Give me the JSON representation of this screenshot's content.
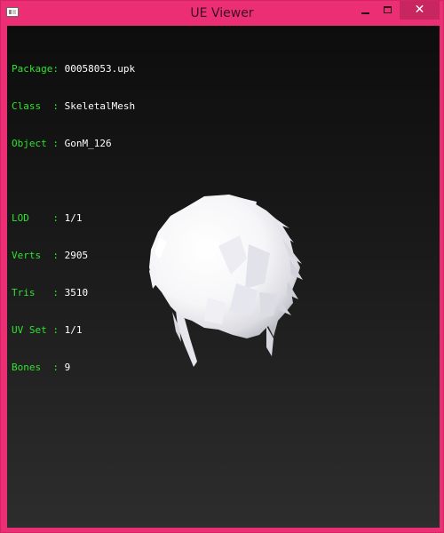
{
  "window": {
    "title": "UE Viewer",
    "icon": "app-window-icon",
    "controls": {
      "minimize_icon": "minimize-icon",
      "maximize_icon": "maximize-icon",
      "close_label": "✕"
    },
    "colors": {
      "frame": "#ec2f74",
      "close_button": "#c7265f"
    }
  },
  "info": {
    "package_label": "Package:",
    "package_value": "00058053.upk",
    "class_label": "Class  :",
    "class_value": "SkeletalMesh",
    "object_label": "Object :",
    "object_value": "GonM_126",
    "lod_label": "LOD    :",
    "lod_value": "1/1",
    "verts_label": "Verts  :",
    "verts_value": "2905",
    "tris_label": "Tris   :",
    "tris_value": "3510",
    "uvset_label": "UV Set :",
    "uvset_value": "1/1",
    "bones_label": "Bones  :",
    "bones_value": "9",
    "colors": {
      "label": "#2ee32e",
      "value": "#ffffff"
    }
  }
}
